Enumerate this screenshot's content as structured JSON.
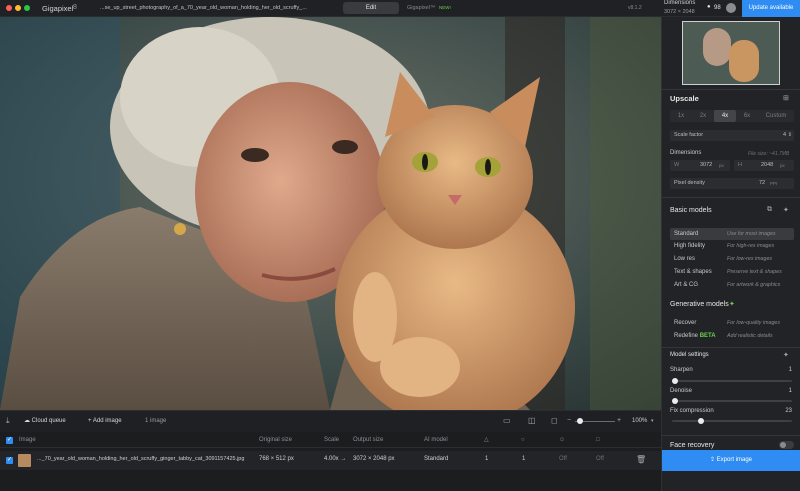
{
  "app": {
    "name": "Gigapixel",
    "version_badge": "8",
    "file_title": "...se_up_street_photography_of_a_70_year_old_woman_holding_her_old_scruffy_...",
    "version": "v8.1.2"
  },
  "header": {
    "edit_tab": "Edit",
    "gigapixel_tab": "Gigapixel™",
    "new_badge": "NEW!",
    "dimensions_label": "Dimensions",
    "dimensions_value": "3072 × 2048",
    "credits": "98",
    "update_button": "Update available"
  },
  "panel": {
    "upscale_title": "Upscale",
    "scale_options": [
      "1x",
      "2x",
      "4x",
      "6x",
      "Custom"
    ],
    "scale_selected": "4x",
    "scale_factor_label": "Scale factor",
    "scale_factor_value": "4",
    "dimensions_label": "Dimensions",
    "file_size": "File size: ~41.7MB",
    "width_label": "W",
    "width_value": "3072",
    "width_unit": "px",
    "height_label": "H",
    "height_value": "2048",
    "height_unit": "px",
    "density_label": "Pixel density",
    "density_value": "72",
    "density_unit": "PPI",
    "basic_models_title": "Basic models",
    "basic_models": [
      {
        "name": "Standard",
        "desc": "Use for most images",
        "selected": true
      },
      {
        "name": "High fidelity",
        "desc": "For high-res images"
      },
      {
        "name": "Low res",
        "desc": "For low-res images"
      },
      {
        "name": "Text & shapes",
        "desc": "Preserve text & shapes"
      },
      {
        "name": "Art & CG",
        "desc": "For artwork & graphics"
      }
    ],
    "generative_title": "Generative models",
    "generative_models": [
      {
        "name": "Recover",
        "desc": "For low-quality images"
      },
      {
        "name": "Redefine",
        "badge": "BETA",
        "desc": "Add realistic details"
      }
    ],
    "model_settings_title": "Model settings",
    "sliders": [
      {
        "label": "Sharpen",
        "value": "1",
        "fraction": 0.0
      },
      {
        "label": "Denoise",
        "value": "1",
        "fraction": 0.0
      },
      {
        "label": "Fix compression",
        "value": "23",
        "fraction": 0.23
      }
    ],
    "face_recovery_label": "Face recovery",
    "export_button": "Export image"
  },
  "toolbar": {
    "cloud_queue": "Cloud queue",
    "add_image": "Add image",
    "image_count": "1 image",
    "zoom": "100%"
  },
  "queue": {
    "headers": {
      "image": "Image",
      "original": "Original size",
      "scale": "Scale",
      "output": "Output size",
      "model": "AI model"
    },
    "row": {
      "filename": "..._70_year_old_woman_holding_her_old_scruffy_ginger_tabby_cat_3091157425.jpg",
      "original": "768 × 512 px",
      "scale": "4.00x →",
      "output": "3072 × 2048 px",
      "model": "Standard",
      "col1": "1",
      "col2": "1",
      "col3": "Off",
      "col4": "Off"
    }
  },
  "colors": {
    "accent": "#2f8cf2",
    "green": "#6ad14a",
    "panel": "#222326"
  }
}
